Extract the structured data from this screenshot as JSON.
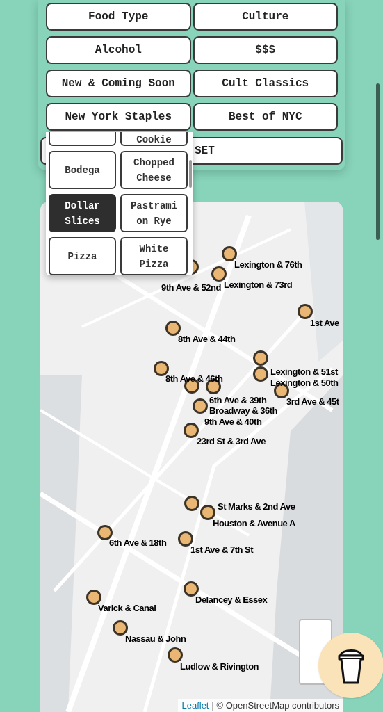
{
  "filters": [
    {
      "label": "Food Type"
    },
    {
      "label": "Culture"
    },
    {
      "label": "Alcohol"
    },
    {
      "label": "$$$"
    },
    {
      "label": "New & Coming Soon"
    },
    {
      "label": "Cult Classics"
    },
    {
      "label": "New York Staples"
    },
    {
      "label": "Best of NYC"
    }
  ],
  "reset_button": {
    "label": "SET"
  },
  "dropdown": {
    "rows": [
      [
        {
          "selected": false
        },
        {
          "label": "Cookie",
          "selected": false
        }
      ],
      [
        {
          "label": "Bodega",
          "selected": false
        },
        {
          "label": "Chopped Cheese",
          "selected": false
        }
      ],
      [
        {
          "label": "Dollar Slices",
          "selected": true
        },
        {
          "label": "Pastrami on Rye",
          "selected": false
        }
      ],
      [
        {
          "label": "Pizza",
          "selected": false
        },
        {
          "label": "White Pizza",
          "selected": false
        }
      ]
    ]
  },
  "map": {
    "markers": [
      {
        "label": "9th Ave & 52nd"
      },
      {
        "label": "Lexington & 76th"
      },
      {
        "label": "Lexington & 73rd"
      },
      {
        "label": "1st Ave"
      },
      {
        "label": "8th Ave & 44th"
      },
      {
        "label": "8th Ave & 46th"
      },
      {
        "label": "Lexington & 51st"
      },
      {
        "label": "Lexington & 50th"
      },
      {
        "label": "6th Ave & 39th"
      },
      {
        "label": "Broadway & 36th"
      },
      {
        "label": "3rd Ave & 45t"
      },
      {
        "label": "9th Ave & 40th"
      },
      {
        "label": "23rd St & 3rd Ave"
      },
      {
        "label": "St Marks & 2nd Ave"
      },
      {
        "label": "Houston & Avenue A"
      },
      {
        "label": "6th Ave & 18th"
      },
      {
        "label": "1st Ave & 7th St"
      },
      {
        "label": "Delancey & Essex"
      },
      {
        "label": "Varick & Canal"
      },
      {
        "label": "Nassau & John"
      },
      {
        "label": "Ludlow & Rivington"
      }
    ],
    "attribution": {
      "link": "Leaflet",
      "text": "| © OpenStreetMap contributors"
    }
  }
}
